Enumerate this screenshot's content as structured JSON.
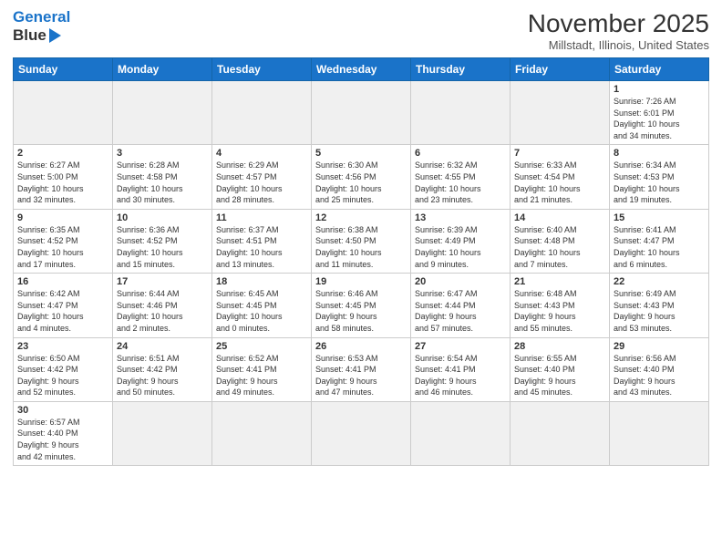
{
  "header": {
    "logo_line1": "General",
    "logo_line2": "Blue",
    "title": "November 2025",
    "subtitle": "Millstadt, Illinois, United States"
  },
  "days_of_week": [
    "Sunday",
    "Monday",
    "Tuesday",
    "Wednesday",
    "Thursday",
    "Friday",
    "Saturday"
  ],
  "weeks": [
    [
      {
        "day": "",
        "info": ""
      },
      {
        "day": "",
        "info": ""
      },
      {
        "day": "",
        "info": ""
      },
      {
        "day": "",
        "info": ""
      },
      {
        "day": "",
        "info": ""
      },
      {
        "day": "",
        "info": ""
      },
      {
        "day": "1",
        "info": "Sunrise: 7:26 AM\nSunset: 6:01 PM\nDaylight: 10 hours\nand 34 minutes."
      }
    ],
    [
      {
        "day": "2",
        "info": "Sunrise: 6:27 AM\nSunset: 5:00 PM\nDaylight: 10 hours\nand 32 minutes."
      },
      {
        "day": "3",
        "info": "Sunrise: 6:28 AM\nSunset: 4:58 PM\nDaylight: 10 hours\nand 30 minutes."
      },
      {
        "day": "4",
        "info": "Sunrise: 6:29 AM\nSunset: 4:57 PM\nDaylight: 10 hours\nand 28 minutes."
      },
      {
        "day": "5",
        "info": "Sunrise: 6:30 AM\nSunset: 4:56 PM\nDaylight: 10 hours\nand 25 minutes."
      },
      {
        "day": "6",
        "info": "Sunrise: 6:32 AM\nSunset: 4:55 PM\nDaylight: 10 hours\nand 23 minutes."
      },
      {
        "day": "7",
        "info": "Sunrise: 6:33 AM\nSunset: 4:54 PM\nDaylight: 10 hours\nand 21 minutes."
      },
      {
        "day": "8",
        "info": "Sunrise: 6:34 AM\nSunset: 4:53 PM\nDaylight: 10 hours\nand 19 minutes."
      }
    ],
    [
      {
        "day": "9",
        "info": "Sunrise: 6:35 AM\nSunset: 4:52 PM\nDaylight: 10 hours\nand 17 minutes."
      },
      {
        "day": "10",
        "info": "Sunrise: 6:36 AM\nSunset: 4:52 PM\nDaylight: 10 hours\nand 15 minutes."
      },
      {
        "day": "11",
        "info": "Sunrise: 6:37 AM\nSunset: 4:51 PM\nDaylight: 10 hours\nand 13 minutes."
      },
      {
        "day": "12",
        "info": "Sunrise: 6:38 AM\nSunset: 4:50 PM\nDaylight: 10 hours\nand 11 minutes."
      },
      {
        "day": "13",
        "info": "Sunrise: 6:39 AM\nSunset: 4:49 PM\nDaylight: 10 hours\nand 9 minutes."
      },
      {
        "day": "14",
        "info": "Sunrise: 6:40 AM\nSunset: 4:48 PM\nDaylight: 10 hours\nand 7 minutes."
      },
      {
        "day": "15",
        "info": "Sunrise: 6:41 AM\nSunset: 4:47 PM\nDaylight: 10 hours\nand 6 minutes."
      }
    ],
    [
      {
        "day": "16",
        "info": "Sunrise: 6:42 AM\nSunset: 4:47 PM\nDaylight: 10 hours\nand 4 minutes."
      },
      {
        "day": "17",
        "info": "Sunrise: 6:44 AM\nSunset: 4:46 PM\nDaylight: 10 hours\nand 2 minutes."
      },
      {
        "day": "18",
        "info": "Sunrise: 6:45 AM\nSunset: 4:45 PM\nDaylight: 10 hours\nand 0 minutes."
      },
      {
        "day": "19",
        "info": "Sunrise: 6:46 AM\nSunset: 4:45 PM\nDaylight: 9 hours\nand 58 minutes."
      },
      {
        "day": "20",
        "info": "Sunrise: 6:47 AM\nSunset: 4:44 PM\nDaylight: 9 hours\nand 57 minutes."
      },
      {
        "day": "21",
        "info": "Sunrise: 6:48 AM\nSunset: 4:43 PM\nDaylight: 9 hours\nand 55 minutes."
      },
      {
        "day": "22",
        "info": "Sunrise: 6:49 AM\nSunset: 4:43 PM\nDaylight: 9 hours\nand 53 minutes."
      }
    ],
    [
      {
        "day": "23",
        "info": "Sunrise: 6:50 AM\nSunset: 4:42 PM\nDaylight: 9 hours\nand 52 minutes."
      },
      {
        "day": "24",
        "info": "Sunrise: 6:51 AM\nSunset: 4:42 PM\nDaylight: 9 hours\nand 50 minutes."
      },
      {
        "day": "25",
        "info": "Sunrise: 6:52 AM\nSunset: 4:41 PM\nDaylight: 9 hours\nand 49 minutes."
      },
      {
        "day": "26",
        "info": "Sunrise: 6:53 AM\nSunset: 4:41 PM\nDaylight: 9 hours\nand 47 minutes."
      },
      {
        "day": "27",
        "info": "Sunrise: 6:54 AM\nSunset: 4:41 PM\nDaylight: 9 hours\nand 46 minutes."
      },
      {
        "day": "28",
        "info": "Sunrise: 6:55 AM\nSunset: 4:40 PM\nDaylight: 9 hours\nand 45 minutes."
      },
      {
        "day": "29",
        "info": "Sunrise: 6:56 AM\nSunset: 4:40 PM\nDaylight: 9 hours\nand 43 minutes."
      }
    ],
    [
      {
        "day": "30",
        "info": "Sunrise: 6:57 AM\nSunset: 4:40 PM\nDaylight: 9 hours\nand 42 minutes."
      },
      {
        "day": "",
        "info": ""
      },
      {
        "day": "",
        "info": ""
      },
      {
        "day": "",
        "info": ""
      },
      {
        "day": "",
        "info": ""
      },
      {
        "day": "",
        "info": ""
      },
      {
        "day": "",
        "info": ""
      }
    ]
  ]
}
